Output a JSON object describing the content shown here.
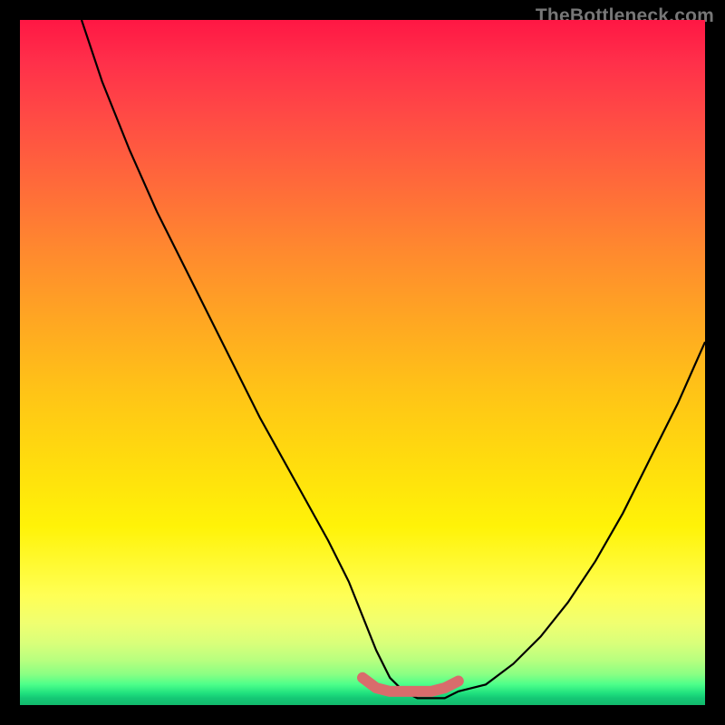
{
  "watermark": {
    "text": "TheBottleneck.com"
  },
  "chart_data": {
    "type": "line",
    "title": "",
    "xlabel": "",
    "ylabel": "",
    "xlim": [
      0,
      100
    ],
    "ylim": [
      0,
      100
    ],
    "grid": false,
    "series": [
      {
        "name": "bottleneck-curve",
        "x": [
          9,
          12,
          16,
          20,
          25,
          30,
          35,
          40,
          45,
          48,
          50,
          52,
          54,
          56,
          58,
          60,
          62,
          64,
          68,
          72,
          76,
          80,
          84,
          88,
          92,
          96,
          100
        ],
        "values": [
          100,
          91,
          81,
          72,
          62,
          52,
          42,
          33,
          24,
          18,
          13,
          8,
          4,
          2,
          1,
          1,
          1,
          2,
          3,
          6,
          10,
          15,
          21,
          28,
          36,
          44,
          53
        ]
      },
      {
        "name": "highlight-band",
        "x": [
          50,
          52,
          54,
          56,
          58,
          60,
          62,
          64
        ],
        "values": [
          4,
          2.5,
          2,
          2,
          2,
          2,
          2.5,
          3.5
        ]
      }
    ],
    "colors": {
      "curve": "#000000",
      "highlight": "#d96c6c"
    }
  }
}
